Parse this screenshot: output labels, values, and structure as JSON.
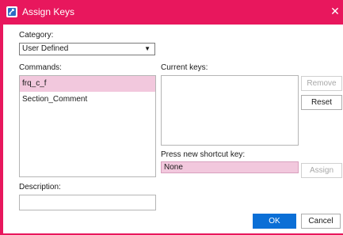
{
  "window": {
    "title": "Assign Keys",
    "close_glyph": "✕",
    "accent_color": "#e8175d"
  },
  "category": {
    "label": "Category:",
    "selected": "User Defined",
    "arrow_glyph": "▼"
  },
  "commands": {
    "label": "Commands:",
    "items": [
      {
        "label": "frq_c_f",
        "selected": true
      },
      {
        "label": "Section_Comment",
        "selected": false
      }
    ]
  },
  "current_keys": {
    "label": "Current keys:"
  },
  "shortcut": {
    "label": "Press new shortcut key:",
    "value": "None"
  },
  "description": {
    "label": "Description:",
    "value": ""
  },
  "buttons": {
    "remove": "Remove",
    "reset": "Reset",
    "assign": "Assign",
    "ok": "OK",
    "cancel": "Cancel"
  },
  "icons": {
    "app_icon": "assign-keys-app-icon",
    "close_icon": "close-icon",
    "dropdown_icon": "chevron-down-icon"
  },
  "colors": {
    "selection": "#f2c8dd",
    "primary_button": "#0b6fd6"
  }
}
